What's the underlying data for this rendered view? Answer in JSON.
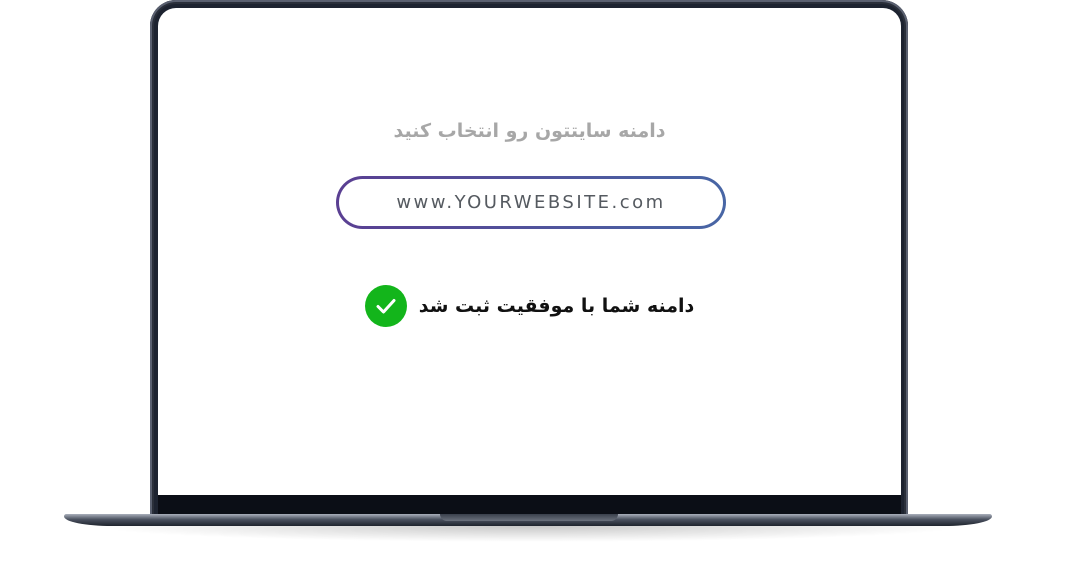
{
  "screen": {
    "prompt": "دامنه سایتتون رو انتخاب کنید",
    "domain_input": {
      "value": "",
      "placeholder": "www.YOURWEBSITE.com"
    },
    "status": {
      "icon": "check-circle-icon",
      "text": "دامنه شما با موفقیت ثبت شد",
      "color": "#13b51b"
    }
  },
  "colors": {
    "input_border_start": "#5a3f92",
    "input_border_end": "#4866a5",
    "prompt_text": "#a7a7a7",
    "device_body": "#1d2330"
  }
}
